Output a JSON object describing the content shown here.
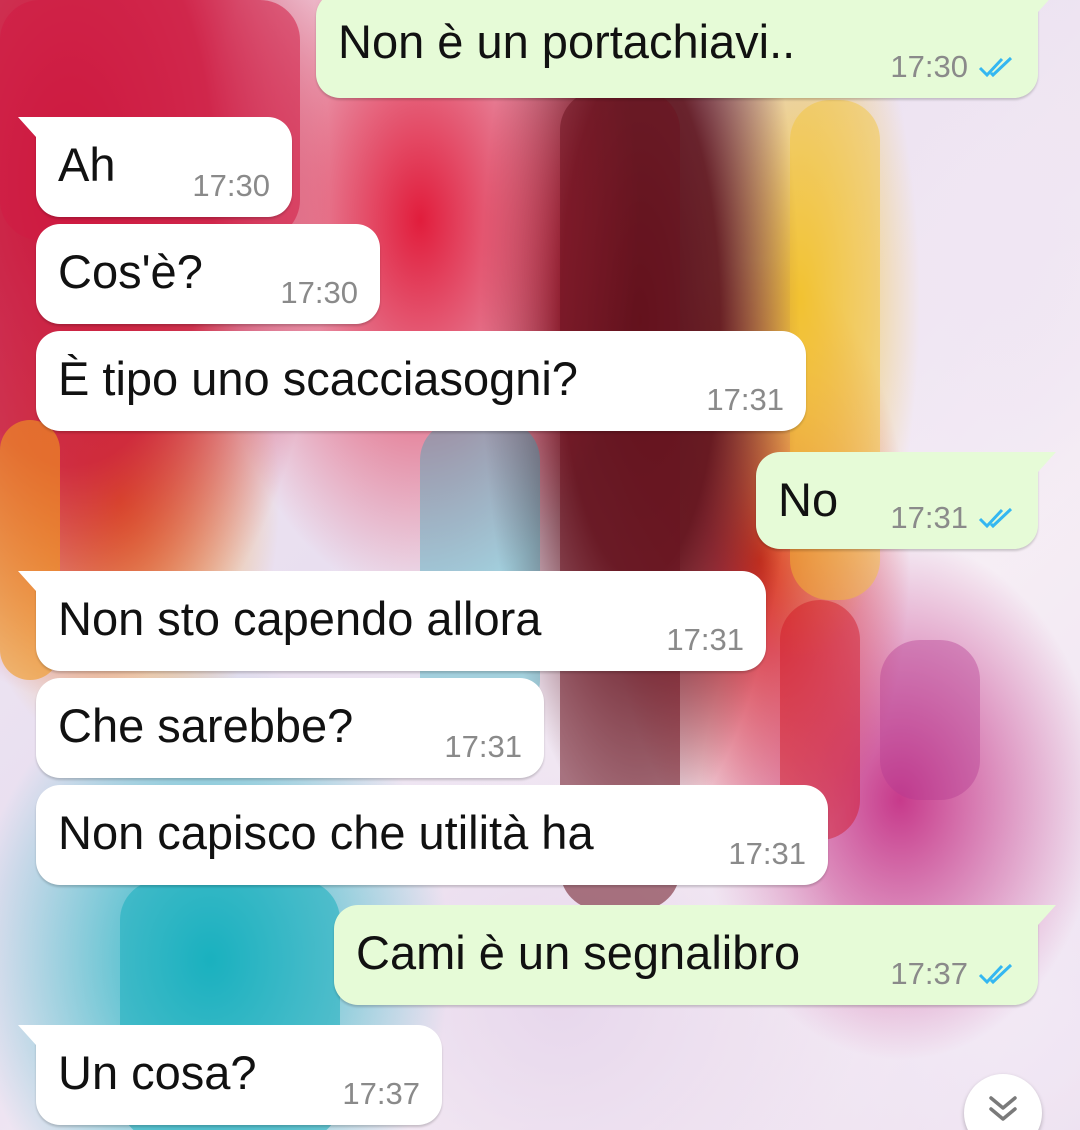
{
  "messages": [
    {
      "direction": "out",
      "text": "Non è un portachiavi..",
      "time": "17:30",
      "status": "read"
    },
    {
      "direction": "in",
      "text": "Ah",
      "time": "17:30"
    },
    {
      "direction": "in",
      "text": "Cos'è?",
      "time": "17:30"
    },
    {
      "direction": "in",
      "text": "È tipo uno scacciasogni?",
      "time": "17:31"
    },
    {
      "direction": "out",
      "text": "No",
      "time": "17:31",
      "status": "read"
    },
    {
      "direction": "in",
      "text": "Non sto capendo allora",
      "time": "17:31"
    },
    {
      "direction": "in",
      "text": "Che sarebbe?",
      "time": "17:31"
    },
    {
      "direction": "in",
      "text": "Non capisco che utilità ha",
      "time": "17:31"
    },
    {
      "direction": "out",
      "text": "Cami è un segnalibro",
      "time": "17:37",
      "status": "read"
    },
    {
      "direction": "in",
      "text": "Un cosa?",
      "time": "17:37"
    }
  ],
  "icons": {
    "read_ticks": "double-check-icon",
    "scroll_down": "chevron-double-down-icon"
  },
  "colors": {
    "incoming_bubble": "#ffffff",
    "outgoing_bubble": "#e6fbd7",
    "read_tick": "#34b7f1",
    "timestamp": "#8a8a8a"
  }
}
